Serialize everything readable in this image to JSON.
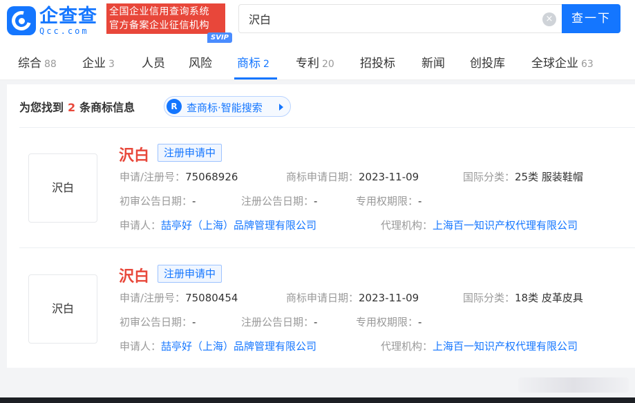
{
  "header": {
    "logo_cn": "企查查",
    "logo_en": "Qcc.com",
    "badge_line1": "全国企业信用查询系统",
    "badge_line2": "官方备案企业征信机构",
    "search_value": "沢白",
    "search_button": "查一下",
    "clear_glyph": "×",
    "brand_color": "#1476ff",
    "accent_red": "#e8473a"
  },
  "tabs": [
    {
      "label": "综合",
      "count": "88"
    },
    {
      "label": "企业",
      "count": "3"
    },
    {
      "label": "人员",
      "count": ""
    },
    {
      "label": "风险",
      "count": ""
    },
    {
      "label": "商标",
      "count": "2"
    },
    {
      "label": "专利",
      "count": "20"
    },
    {
      "label": "招投标",
      "count": ""
    },
    {
      "label": "新闻",
      "count": ""
    },
    {
      "label": "创投库",
      "count": ""
    },
    {
      "label": "全球企业",
      "count": "63"
    }
  ],
  "active_tab": "商标",
  "svip_badge": "SVIP",
  "summary": {
    "prefix": "为您找到",
    "count": "2",
    "suffix": "条商标信息",
    "smart_icon": "R",
    "smart_label": "查商标·智能搜索"
  },
  "results": [
    {
      "thumb_text": "沢白",
      "name": "沢白",
      "status": "注册申请中",
      "reg_label": "申请/注册号：",
      "reg_no": "75068926",
      "apply_date_label": "商标申请日期：",
      "apply_date": "2023-11-09",
      "class_label": "国际分类：",
      "class_value": "25类 服装鞋帽",
      "prelim_label": "初审公告日期：",
      "prelim_value": "-",
      "reg_notice_label": "注册公告日期：",
      "reg_notice_value": "-",
      "exclusive_label": "专用权期限：",
      "exclusive_value": "-",
      "applicant_label": "申请人：",
      "applicant": "喆亭好（上海）品牌管理有限公司",
      "agent_label": "代理机构：",
      "agent": "上海百一知识产权代理有限公司"
    },
    {
      "thumb_text": "沢白",
      "name": "沢白",
      "status": "注册申请中",
      "reg_label": "申请/注册号：",
      "reg_no": "75080454",
      "apply_date_label": "商标申请日期：",
      "apply_date": "2023-11-09",
      "class_label": "国际分类：",
      "class_value": "18类 皮革皮具",
      "prelim_label": "初审公告日期：",
      "prelim_value": "-",
      "reg_notice_label": "注册公告日期：",
      "reg_notice_value": "-",
      "exclusive_label": "专用权期限：",
      "exclusive_value": "-",
      "applicant_label": "申请人：",
      "applicant": "喆亭好（上海）品牌管理有限公司",
      "agent_label": "代理机构：",
      "agent": "上海百一知识产权代理有限公司"
    }
  ]
}
